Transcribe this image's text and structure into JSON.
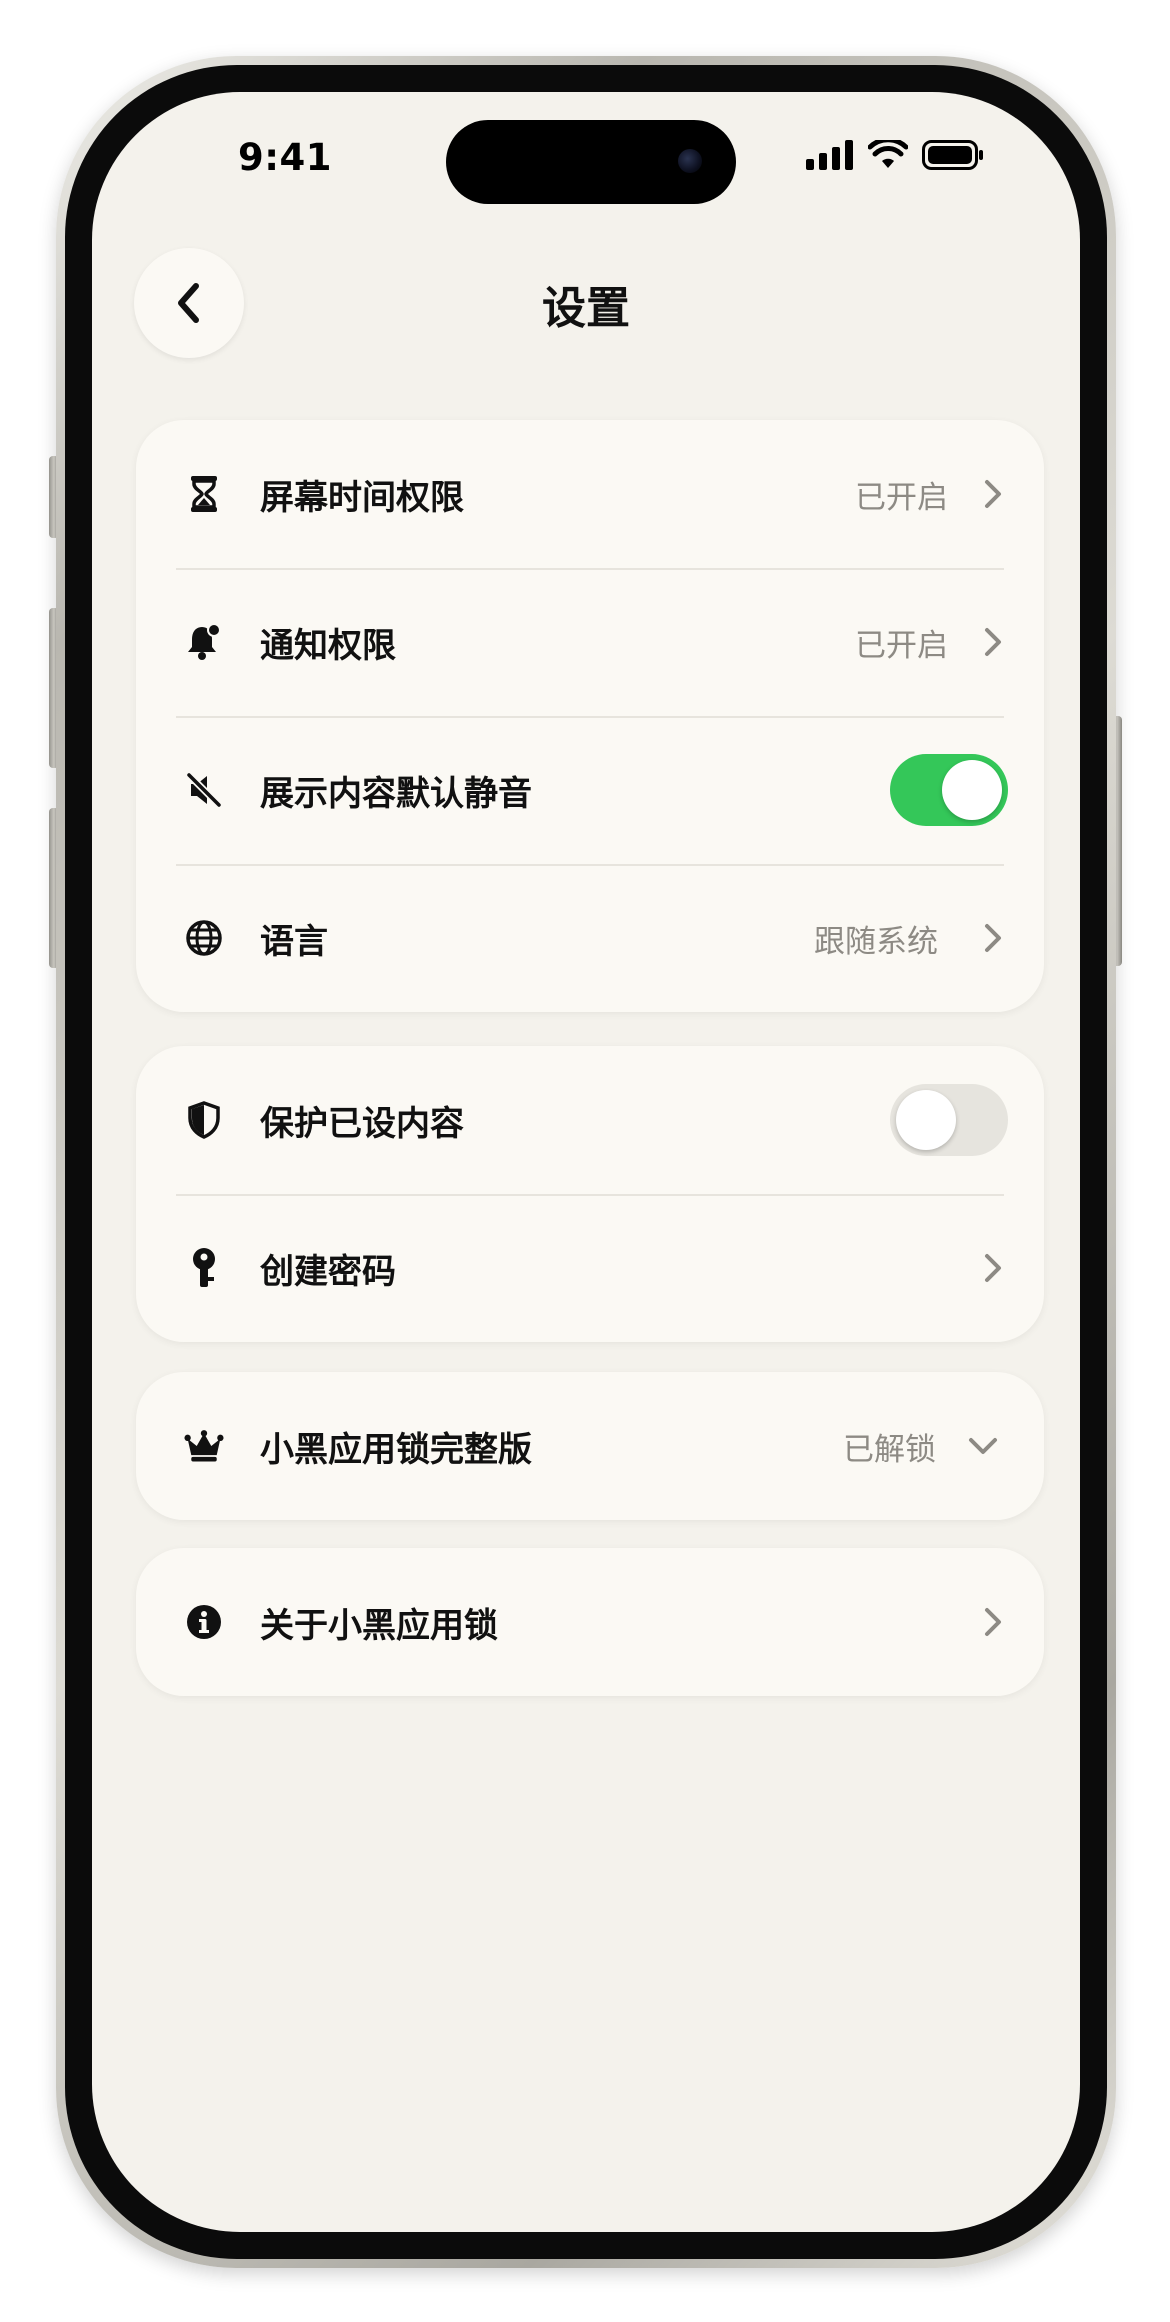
{
  "status_bar": {
    "time": "9:41"
  },
  "header": {
    "title": "设置",
    "back_icon": "chevron-left-icon"
  },
  "groups": [
    {
      "items": [
        {
          "icon": "hourglass-icon",
          "label": "屏幕时间权限",
          "value": "已开启",
          "control": "chevron-right"
        },
        {
          "icon": "bell-icon",
          "label": "通知权限",
          "value": "已开启",
          "control": "chevron-right"
        },
        {
          "icon": "speaker-mute-icon",
          "label": "展示内容默认静音",
          "control": "toggle",
          "toggle_on": true
        },
        {
          "icon": "globe-icon",
          "label": "语言",
          "value": "跟随系统",
          "control": "chevron-right"
        }
      ]
    },
    {
      "items": [
        {
          "icon": "shield-icon",
          "label": "保护已设内容",
          "control": "toggle",
          "toggle_on": false
        },
        {
          "icon": "key-icon",
          "label": "创建密码",
          "control": "chevron-right"
        }
      ]
    },
    {
      "items": [
        {
          "icon": "crown-icon",
          "label": "小黑应用锁完整版",
          "value": "已解锁",
          "control": "chevron-down"
        }
      ]
    },
    {
      "items": [
        {
          "icon": "info-icon",
          "label": "关于小黑应用锁",
          "control": "chevron-right"
        }
      ]
    }
  ],
  "colors": {
    "background": "#f4f2ec",
    "card": "#fbf9f4",
    "toggle_on": "#34c759",
    "secondary_text": "#8d8a84"
  }
}
